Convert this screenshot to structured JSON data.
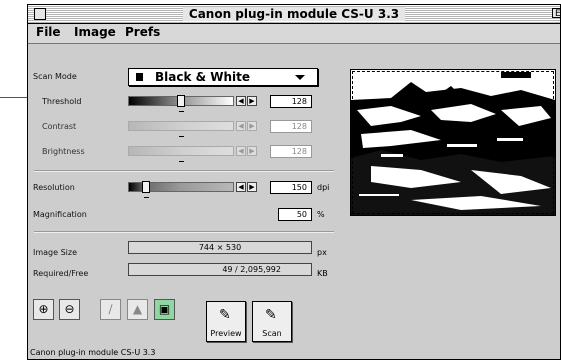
{
  "window": {
    "title": "Canon plug-in module CS-U 3.3",
    "zoom_glyph": "E"
  },
  "menu": [
    "File",
    "Image",
    "Prefs"
  ],
  "scan_mode": {
    "label": "Scan Mode",
    "value": "Black & White"
  },
  "threshold": {
    "label": "Threshold",
    "value": "128",
    "level": 0.5
  },
  "contrast": {
    "label": "Contrast",
    "value": "128",
    "level": 0.5
  },
  "brightness": {
    "label": "Brightness",
    "value": "128",
    "level": 0.5
  },
  "resolution": {
    "label": "Resolution",
    "value": "150",
    "unit": "dpi",
    "level": 0.08
  },
  "magnification": {
    "label": "Magnification",
    "value": "50",
    "unit": "%"
  },
  "image_size": {
    "label": "Image Size",
    "value": "744 × 530",
    "unit": "px"
  },
  "required_free": {
    "label": "Required/Free",
    "value": "49 / 2,095,992",
    "unit": "KB"
  },
  "tools": [
    "zoom-in-icon",
    "zoom-out-icon",
    "pencil-icon",
    "histogram-icon",
    "image-icon"
  ],
  "buttons": {
    "preview": "Preview",
    "scan": "Scan"
  },
  "status": "Canon plug-in module CS-U 3.3",
  "arrow_left": "◀",
  "arrow_right": "▶"
}
